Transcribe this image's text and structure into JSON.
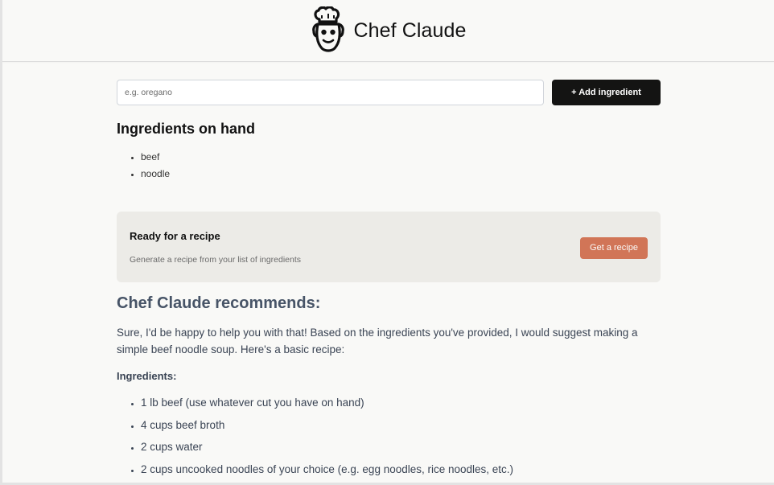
{
  "header": {
    "logo_icon": "chef-hat-face-icon",
    "title": "Chef Claude"
  },
  "add_form": {
    "input_placeholder": "e.g. oregano",
    "input_value": "",
    "button_label": "+ Add ingredient"
  },
  "ingredients_section": {
    "heading": "Ingredients on hand",
    "items": [
      "beef",
      "noodle"
    ]
  },
  "recipe_card": {
    "title": "Ready for a recipe",
    "subtitle": "Generate a recipe from your list of ingredients",
    "button_label": "Get a recipe"
  },
  "recommendation": {
    "heading": "Chef Claude recommends:",
    "intro": "Sure, I'd be happy to help you with that! Based on the ingredients you've provided, I would suggest making a simple beef noodle soup. Here's a basic recipe:",
    "ingredients_label": "Ingredients:",
    "ingredients": [
      "1 lb beef (use whatever cut you have on hand)",
      "4 cups beef broth",
      "2 cups water",
      "2 cups uncooked noodles of your choice (e.g. egg noodles, rice noodles, etc.)"
    ]
  },
  "colors": {
    "page_background": "#f9f9f7",
    "add_button": "#141413",
    "get_recipe_button": "#d17557",
    "card_background": "#ecebe7",
    "recommendation_text": "#475467"
  }
}
